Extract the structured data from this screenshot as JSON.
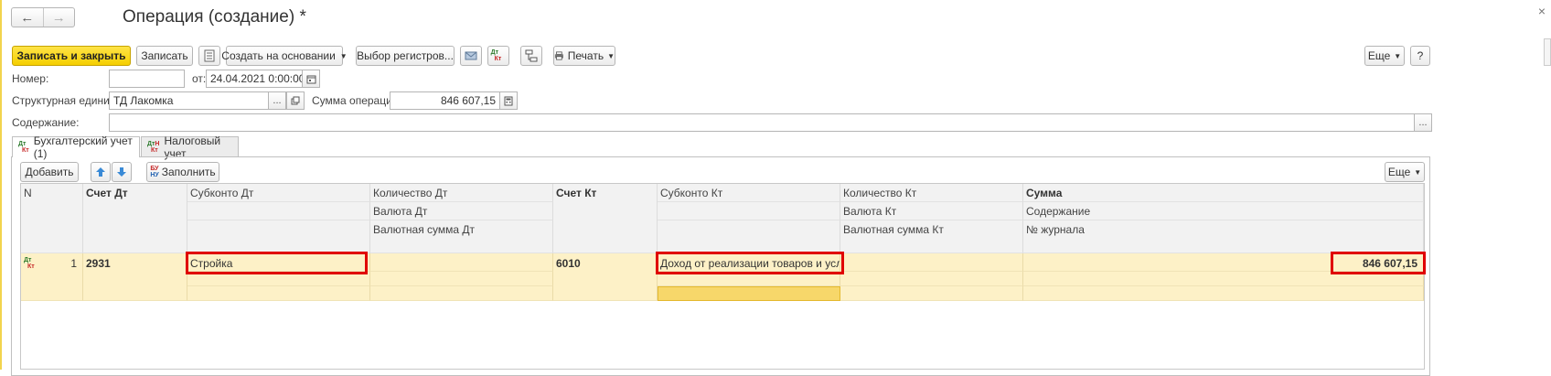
{
  "window": {
    "title": "Операция (создание) *",
    "nav_back_icon": "arrow-left-icon",
    "nav_forward_icon": "arrow-right-icon",
    "close_glyph": "×"
  },
  "toolbar": {
    "save_close_label": "Записать и закрыть",
    "save_label": "Записать",
    "create_based_label": "Создать на основании",
    "register_select_label": "Выбор регистров...",
    "print_label": "Печать",
    "more_label": "Еще",
    "help_label": "?"
  },
  "form": {
    "number_label": "Номер:",
    "number_value": "",
    "date_from_label": "от:",
    "date_value": "24.04.2021  0:00:00",
    "unit_label": "Структурная единица:",
    "unit_value": "ТД Лакомка",
    "amount_label": "Сумма операции:",
    "amount_value": "846 607,15",
    "content_label": "Содержание:",
    "content_value": "",
    "ellipsis": "..."
  },
  "tabs": [
    {
      "label": "Бухгалтерский учет (1)",
      "active": true
    },
    {
      "label": "Налоговый учет",
      "active": false
    }
  ],
  "table_toolbar": {
    "add_label": "Добавить",
    "fill_label": "Заполнить",
    "more_label": "Еще"
  },
  "table": {
    "headers": {
      "n": "N",
      "account_dt": "Счет Дт",
      "subconto_dt": "Субконто Дт",
      "qty_dt": "Количество Дт",
      "currency_dt": "Валюта Дт",
      "cur_sum_dt": "Валютная сумма Дт",
      "account_kt": "Счет Кт",
      "subconto_kt": "Субконто Кт",
      "qty_kt": "Количество Кт",
      "currency_kt": "Валюта Кт",
      "cur_sum_kt": "Валютная сумма Кт",
      "sum": "Сумма",
      "content": "Содержание",
      "journal_no": "№ журнала"
    },
    "rows": [
      {
        "n": "1",
        "account_dt": "2931",
        "subconto_dt": "Стройка",
        "account_kt": "6010",
        "subconto_kt": "Доход от реализации товаров и услуг",
        "sum": "846 607,15"
      }
    ]
  },
  "icons": {
    "dt": "Дт",
    "kt": "Кт",
    "n": "Н"
  },
  "colors": {
    "primary_button": "#f5cf00",
    "selected_row": "#fdf1c7",
    "highlight_box": "#e00000"
  }
}
